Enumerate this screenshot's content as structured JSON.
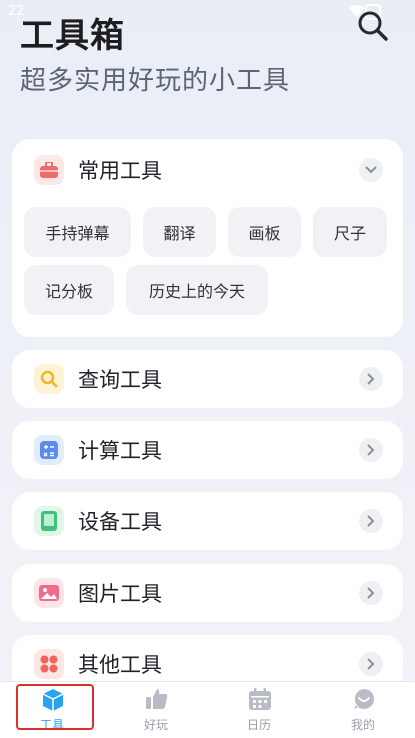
{
  "status_bar": {
    "time": "22"
  },
  "header": {
    "title": "工具箱",
    "subtitle": "超多实用好玩的小工具"
  },
  "common_tools": {
    "title": "常用工具",
    "chips": [
      "手持弹幕",
      "翻译",
      "画板",
      "尺子",
      "记分板",
      "历史上的今天"
    ]
  },
  "categories": [
    {
      "label": "查询工具",
      "icon": "search-icon",
      "color": "#f5b524"
    },
    {
      "label": "计算工具",
      "icon": "calculator-icon",
      "color": "#5b8cf0"
    },
    {
      "label": "设备工具",
      "icon": "tablet-icon",
      "color": "#3ec27a"
    },
    {
      "label": "图片工具",
      "icon": "image-icon",
      "color": "#f06a8a"
    },
    {
      "label": "其他工具",
      "icon": "grid-icon",
      "color": "#f0645c"
    }
  ],
  "tabbar": {
    "items": [
      {
        "label": "工具",
        "icon": "cube-icon",
        "active": true
      },
      {
        "label": "好玩",
        "icon": "thumbs-up-icon",
        "active": false
      },
      {
        "label": "日历",
        "icon": "calendar-icon",
        "active": false
      },
      {
        "label": "我的",
        "icon": "chat-smile-icon",
        "active": false
      }
    ],
    "accent": "#29a3f0"
  },
  "highlight_color": "#d9322b"
}
